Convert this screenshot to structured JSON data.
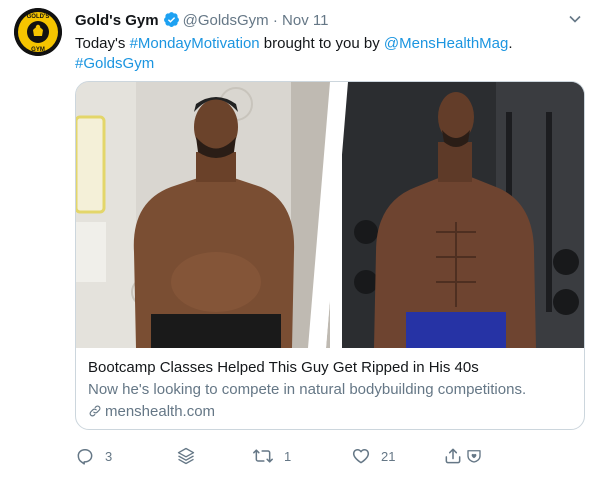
{
  "tweet": {
    "name": "Gold's Gym",
    "handle": "@GoldsGym",
    "separator": "·",
    "date": "Nov 11",
    "text_pre": "Today's ",
    "hashtag1": "#MondayMotivation",
    "text_mid": " brought to you by ",
    "mention": "@MensHealthMag",
    "text_post": ".",
    "hashtag2": "#GoldsGym",
    "avatar_text": "GOLD'S GYM"
  },
  "card": {
    "title": "Bootcamp Classes Helped This Guy Get Ripped in His 40s",
    "description": "Now he's looking to compete in natural bodybuilding competitions.",
    "domain": "menshealth.com"
  },
  "actions": {
    "reply_count": "3",
    "retweet_count": "1",
    "like_count": "21"
  },
  "colors": {
    "link": "#1b95e0",
    "secondary": "#657786",
    "verified": "#1da1f2",
    "border": "#ccd6dd"
  }
}
